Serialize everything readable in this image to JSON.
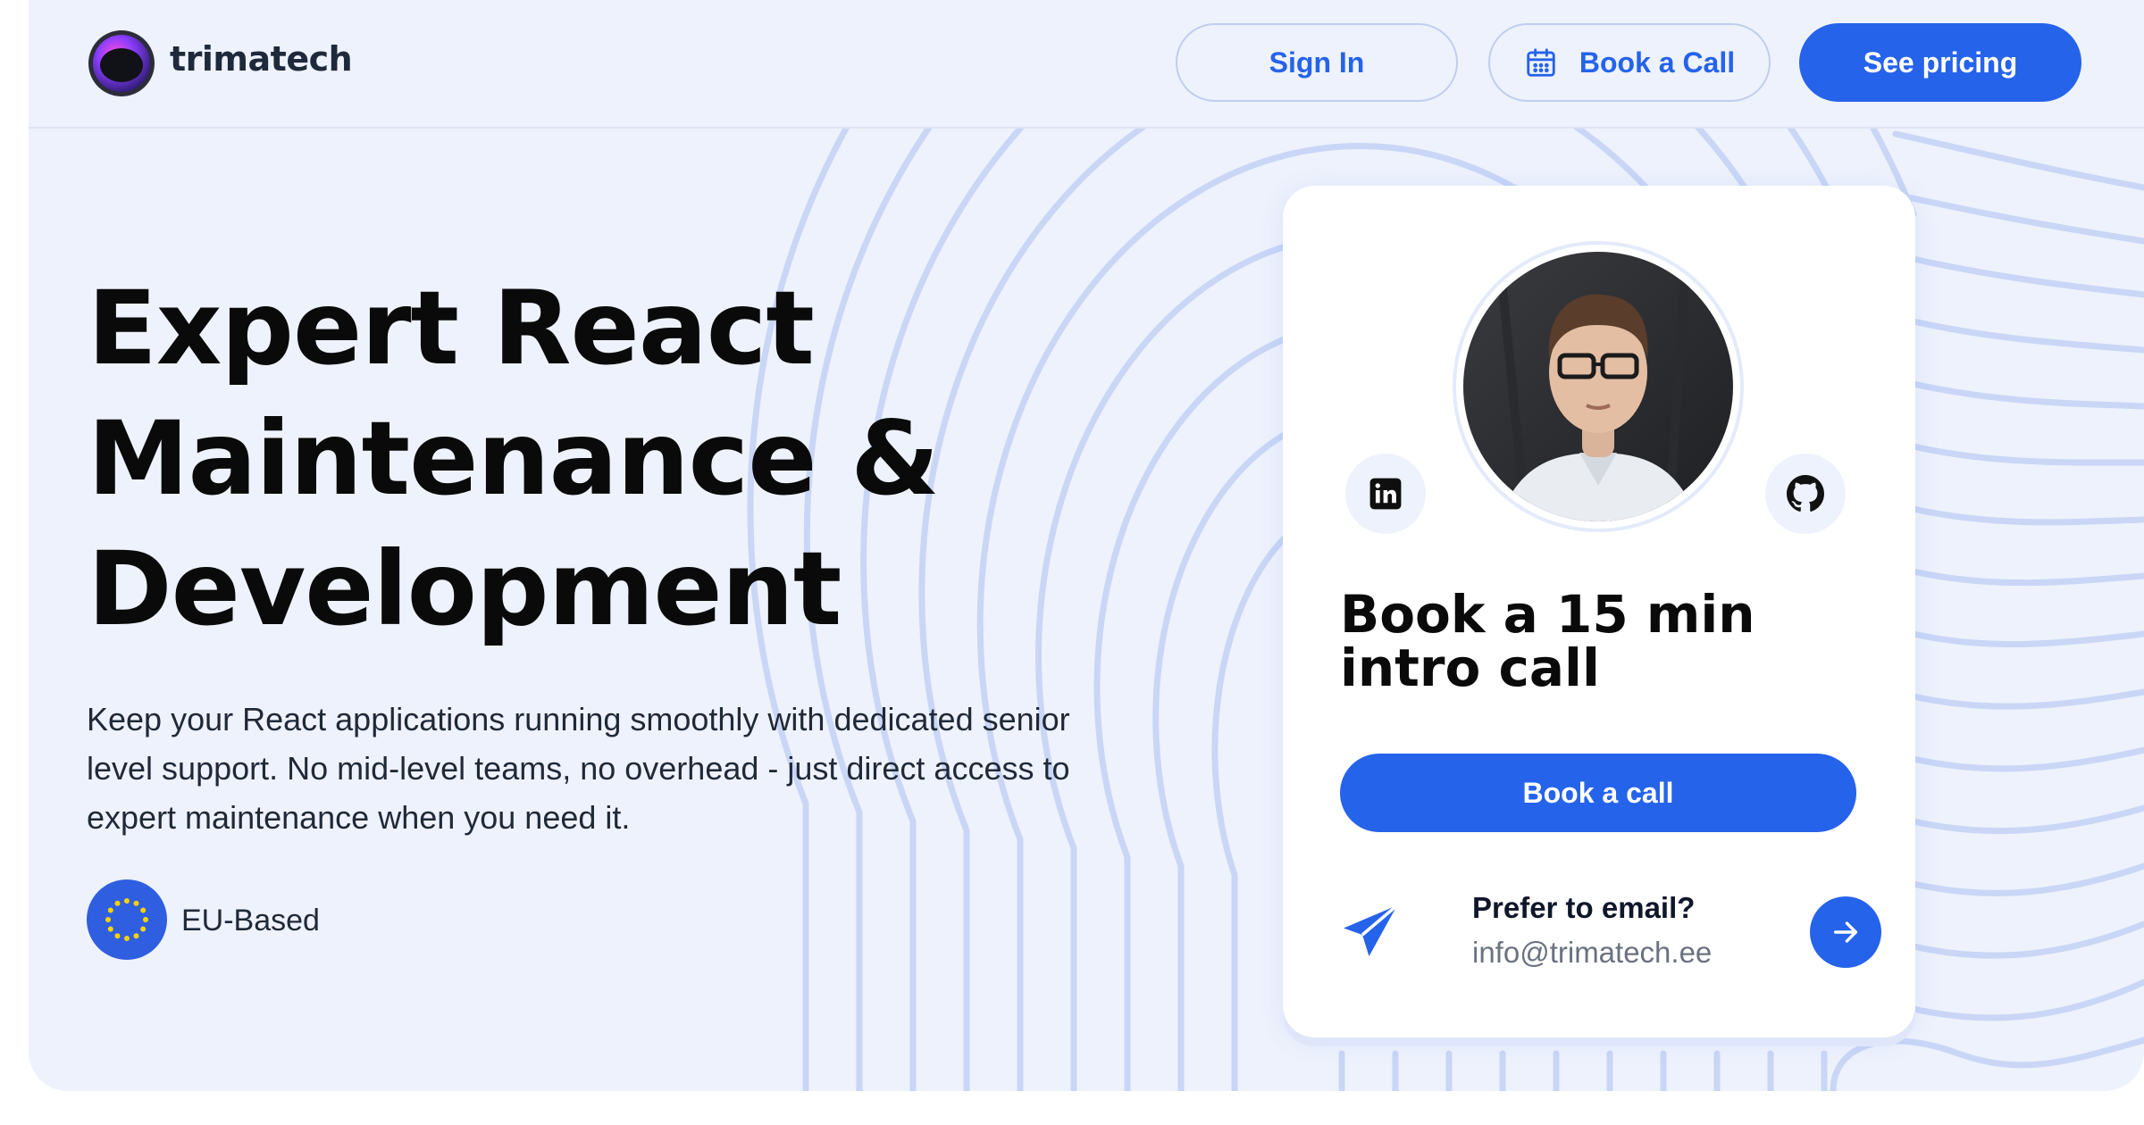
{
  "header": {
    "brand": "trimatech",
    "sign_in_label": "Sign In",
    "book_call_label": "Book a Call",
    "see_pricing_label": "See pricing"
  },
  "hero": {
    "title_lines": [
      "Expert React",
      "Maintenance &",
      "Development"
    ],
    "description": "Keep your React applications running smoothly with dedicated senior level support. No mid-level teams, no overhead - just direct access to expert maintenance when you need it.",
    "badge_label": "EU-Based"
  },
  "card": {
    "title_lines": [
      "Book a 15 min",
      "intro call"
    ],
    "book_button_label": "Book a call",
    "email_prompt": "Prefer to email?",
    "email_address": "info@trimatech.ee"
  },
  "icons": {
    "calendar": "calendar-icon",
    "linkedin": "linkedin-icon",
    "github": "github-icon",
    "send": "paper-plane-icon",
    "arrow": "arrow-right-icon",
    "eu_flag": "eu-flag-icon"
  },
  "colors": {
    "accent": "#2563eb",
    "background": "#eef2fc",
    "background_lines": "#c7d5f6"
  }
}
